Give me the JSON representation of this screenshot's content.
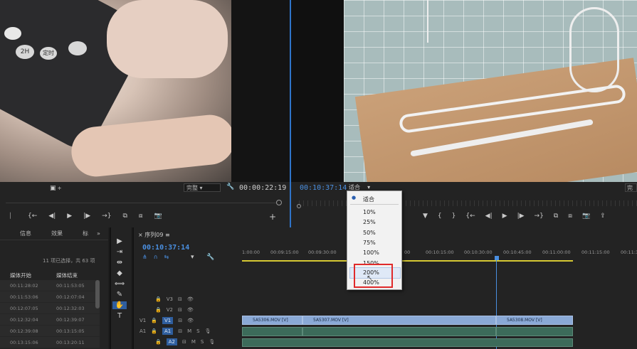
{
  "source_monitor": {
    "tc_out": "00:00:22:19",
    "fit_value": "完整",
    "buttons": [
      "⎸",
      "{←",
      "◀|",
      "▶",
      "|▶",
      "→}",
      "⧉",
      "⧈",
      "📷",
      "+"
    ],
    "remote_labels": [
      "2H",
      "定时"
    ]
  },
  "program_monitor": {
    "tc": "00:10:37:14",
    "fit_value": "适合",
    "right_value": "完",
    "buttons": [
      "▼",
      "{",
      "}",
      "{←",
      "◀|",
      "▶",
      "|▶",
      "→}",
      "⧉",
      "⧈",
      "📷",
      "⇪"
    ]
  },
  "zoom_menu": {
    "checked": "适合",
    "items": [
      "10%",
      "25%",
      "50%",
      "75%",
      "100%",
      "150%",
      "200%",
      "400%"
    ]
  },
  "project_panel": {
    "tabs": [
      "信息",
      "效果",
      "标",
      "»"
    ],
    "status": "11 项已选择，共 63 项",
    "columns": [
      "媒体开始",
      "媒体结束"
    ],
    "rows": [
      [
        "00:11:28:02",
        "00:11:53:05"
      ],
      [
        "00:11:53:06",
        "00:12:07:04"
      ],
      [
        "00:12:07:05",
        "00:12:32:03"
      ],
      [
        "00:12:32:04",
        "00:12:39:07"
      ],
      [
        "00:12:39:08",
        "00:13:15:05"
      ],
      [
        "00:13:15:06",
        "00:13:20:11"
      ]
    ]
  },
  "timeline": {
    "tab": "序列09",
    "tc": "00:10:37:14",
    "ruler": [
      "1:00:00",
      "00:09:15:00",
      "00:09:30:00",
      "00",
      "00:10:15:00",
      "00:10:30:00",
      "00:10:45:00",
      "00:11:00:00",
      "00:11:15:00",
      "00:11:3"
    ],
    "tracks": [
      "V3",
      "V2",
      "V1",
      "A1",
      "A2"
    ],
    "v1_track_label": "V1",
    "a1_track_label": "A1",
    "clips": [
      "5A5306.MOV [V]",
      "5A5307.MOV [V]",
      "5A5308.MOV [V]"
    ]
  },
  "tools": [
    "▶",
    "⇥",
    "⇹",
    "◆",
    "⟺",
    "✎",
    "✋",
    "T"
  ]
}
